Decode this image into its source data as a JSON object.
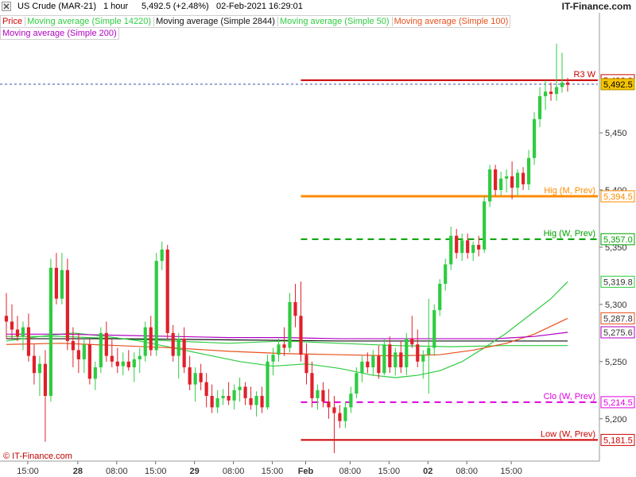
{
  "header": {
    "instrument": "US Crude (MAR-21)",
    "timeframe": "1 hour",
    "quote": "5,492.5 (+2.48%)",
    "datetime": "02-Feb-2021 16:29:01",
    "site": "IT-Finance.com",
    "close_icon": "close-x-icon"
  },
  "legend": {
    "row1": [
      {
        "label": "Price",
        "color": "#d40000"
      },
      {
        "label": "Moving average (Simple 14220)",
        "color": "#2ecc40"
      },
      {
        "label": "Moving average (Simple 2844)",
        "color": "#111111"
      },
      {
        "label": "Moving average (Simple 50)",
        "color": "#2ecc40"
      },
      {
        "label": "Moving average (Simple 100)",
        "color": "#e8501c"
      }
    ],
    "row2": [
      {
        "label": "Moving average (Simple 200)",
        "color": "#b000c0"
      }
    ]
  },
  "footer": {
    "brand": "© IT-Finance.com"
  },
  "chart_data": {
    "type": "candlestick",
    "ylim": [
      5163,
      5555
    ],
    "y_ticks": [
      "5,200",
      "5,250",
      "5,300",
      "5,350",
      "5,400",
      "5,450"
    ],
    "x_ticks": [
      "15:00",
      "28",
      "08:00",
      "15:00",
      "29",
      "08:00",
      "15:00",
      "Feb",
      "08:00",
      "15:00",
      "02",
      "08:00",
      "15:00"
    ],
    "bold_ticks": [
      "28",
      "29",
      "Feb",
      "02"
    ],
    "candles": [
      [
        5290,
        5310,
        5270,
        5285
      ],
      [
        5285,
        5300,
        5270,
        5278
      ],
      [
        5278,
        5290,
        5268,
        5272
      ],
      [
        5272,
        5285,
        5260,
        5280
      ],
      [
        5280,
        5292,
        5250,
        5255
      ],
      [
        5255,
        5265,
        5230,
        5240
      ],
      [
        5240,
        5255,
        5220,
        5248
      ],
      [
        5248,
        5260,
        5180,
        5220
      ],
      [
        5220,
        5340,
        5215,
        5332
      ],
      [
        5332,
        5345,
        5300,
        5305
      ],
      [
        5305,
        5345,
        5300,
        5330
      ],
      [
        5330,
        5340,
        5260,
        5268
      ],
      [
        5268,
        5280,
        5245,
        5260
      ],
      [
        5260,
        5275,
        5240,
        5252
      ],
      [
        5252,
        5270,
        5240,
        5265
      ],
      [
        5265,
        5270,
        5230,
        5235
      ],
      [
        5235,
        5250,
        5225,
        5245
      ],
      [
        5245,
        5280,
        5240,
        5275
      ],
      [
        5275,
        5285,
        5250,
        5255
      ],
      [
        5255,
        5270,
        5245,
        5250
      ],
      [
        5250,
        5262,
        5240,
        5246
      ],
      [
        5246,
        5258,
        5238,
        5250
      ],
      [
        5250,
        5260,
        5242,
        5245
      ],
      [
        5245,
        5258,
        5232,
        5252
      ],
      [
        5252,
        5262,
        5240,
        5255
      ],
      [
        5255,
        5285,
        5250,
        5280
      ],
      [
        5280,
        5290,
        5255,
        5260
      ],
      [
        5260,
        5345,
        5255,
        5338
      ],
      [
        5338,
        5355,
        5330,
        5348
      ],
      [
        5348,
        5352,
        5270,
        5275
      ],
      [
        5275,
        5282,
        5250,
        5255
      ],
      [
        5255,
        5275,
        5235,
        5270
      ],
      [
        5270,
        5280,
        5240,
        5245
      ],
      [
        5245,
        5255,
        5225,
        5230
      ],
      [
        5230,
        5245,
        5215,
        5240
      ],
      [
        5240,
        5248,
        5225,
        5232
      ],
      [
        5232,
        5240,
        5210,
        5220
      ],
      [
        5220,
        5230,
        5205,
        5210
      ],
      [
        5210,
        5225,
        5205,
        5218
      ],
      [
        5218,
        5226,
        5212,
        5220
      ],
      [
        5220,
        5232,
        5212,
        5216
      ],
      [
        5216,
        5230,
        5208,
        5225
      ],
      [
        5225,
        5236,
        5215,
        5228
      ],
      [
        5228,
        5232,
        5212,
        5218
      ],
      [
        5218,
        5228,
        5208,
        5212
      ],
      [
        5212,
        5224,
        5202,
        5220
      ],
      [
        5220,
        5228,
        5205,
        5210
      ],
      [
        5210,
        5256,
        5208,
        5250
      ],
      [
        5250,
        5262,
        5238,
        5256
      ],
      [
        5256,
        5270,
        5250,
        5265
      ],
      [
        5265,
        5280,
        5255,
        5262
      ],
      [
        5262,
        5310,
        5258,
        5302
      ],
      [
        5302,
        5318,
        5280,
        5290
      ],
      [
        5290,
        5320,
        5250,
        5256
      ],
      [
        5256,
        5266,
        5230,
        5240
      ],
      [
        5240,
        5250,
        5210,
        5218
      ],
      [
        5218,
        5230,
        5208,
        5225
      ],
      [
        5225,
        5232,
        5210,
        5215
      ],
      [
        5215,
        5226,
        5200,
        5210
      ],
      [
        5210,
        5220,
        5170,
        5205
      ],
      [
        5205,
        5212,
        5192,
        5198
      ],
      [
        5198,
        5215,
        5192,
        5210
      ],
      [
        5210,
        5228,
        5205,
        5222
      ],
      [
        5222,
        5245,
        5218,
        5240
      ],
      [
        5240,
        5255,
        5232,
        5250
      ],
      [
        5250,
        5258,
        5240,
        5245
      ],
      [
        5245,
        5260,
        5238,
        5255
      ],
      [
        5255,
        5264,
        5235,
        5240
      ],
      [
        5240,
        5270,
        5238,
        5265
      ],
      [
        5265,
        5272,
        5240,
        5245
      ],
      [
        5245,
        5262,
        5238,
        5258
      ],
      [
        5258,
        5268,
        5240,
        5245
      ],
      [
        5245,
        5275,
        5238,
        5270
      ],
      [
        5270,
        5290,
        5262,
        5265
      ],
      [
        5265,
        5278,
        5245,
        5250
      ],
      [
        5250,
        5260,
        5235,
        5256
      ],
      [
        5256,
        5305,
        5222,
        5262
      ],
      [
        5262,
        5300,
        5255,
        5295
      ],
      [
        5295,
        5322,
        5290,
        5318
      ],
      [
        5318,
        5340,
        5312,
        5335
      ],
      [
        5335,
        5368,
        5330,
        5360
      ],
      [
        5360,
        5366,
        5340,
        5345
      ],
      [
        5345,
        5362,
        5338,
        5356
      ],
      [
        5356,
        5362,
        5340,
        5345
      ],
      [
        5345,
        5355,
        5338,
        5352
      ],
      [
        5352,
        5360,
        5342,
        5348
      ],
      [
        5348,
        5395,
        5345,
        5390
      ],
      [
        5390,
        5422,
        5385,
        5418
      ],
      [
        5418,
        5422,
        5395,
        5400
      ],
      [
        5400,
        5416,
        5395,
        5410
      ],
      [
        5410,
        5418,
        5398,
        5412
      ],
      [
        5412,
        5425,
        5392,
        5402
      ],
      [
        5402,
        5418,
        5395,
        5415
      ],
      [
        5415,
        5420,
        5400,
        5405
      ],
      [
        5405,
        5435,
        5400,
        5428
      ],
      [
        5428,
        5468,
        5422,
        5462
      ],
      [
        5462,
        5490,
        5455,
        5482
      ],
      [
        5482,
        5496,
        5470,
        5486
      ],
      [
        5486,
        5494,
        5478,
        5484
      ],
      [
        5484,
        5528,
        5478,
        5490
      ],
      [
        5490,
        5520,
        5485,
        5494
      ],
      [
        5494,
        5498,
        5486,
        5492
      ]
    ],
    "moving_averages": [
      {
        "name": "Moving average (Simple 14220)",
        "color": "#2ecc40",
        "values": [
          [
            0,
            5272
          ],
          [
            10,
            5272
          ],
          [
            20,
            5270
          ],
          [
            30,
            5268
          ],
          [
            40,
            5266
          ],
          [
            50,
            5268
          ],
          [
            60,
            5266
          ],
          [
            70,
            5264
          ],
          [
            80,
            5263
          ],
          [
            90,
            5264
          ],
          [
            101,
            5264
          ]
        ]
      },
      {
        "name": "Moving average (Simple 2844)",
        "color": "#111111",
        "values": [
          [
            0,
            5270
          ],
          [
            20,
            5270
          ],
          [
            40,
            5269
          ],
          [
            60,
            5268
          ],
          [
            80,
            5268
          ],
          [
            101,
            5268
          ]
        ]
      },
      {
        "name": "Moving average (Simple 50)",
        "color": "#2ecc40",
        "values": [
          [
            0,
            5268
          ],
          [
            6,
            5272
          ],
          [
            12,
            5275
          ],
          [
            18,
            5272
          ],
          [
            24,
            5268
          ],
          [
            30,
            5262
          ],
          [
            36,
            5256
          ],
          [
            42,
            5250
          ],
          [
            48,
            5246
          ],
          [
            54,
            5248
          ],
          [
            60,
            5244
          ],
          [
            66,
            5238
          ],
          [
            70,
            5236
          ],
          [
            74,
            5238
          ],
          [
            78,
            5242
          ],
          [
            82,
            5250
          ],
          [
            86,
            5262
          ],
          [
            90,
            5275
          ],
          [
            94,
            5290
          ],
          [
            98,
            5305
          ],
          [
            101,
            5319.8
          ]
        ]
      },
      {
        "name": "Moving average (Simple 100)",
        "color": "#e8501c",
        "values": [
          [
            0,
            5265
          ],
          [
            10,
            5266
          ],
          [
            20,
            5264
          ],
          [
            30,
            5262
          ],
          [
            40,
            5259
          ],
          [
            50,
            5257
          ],
          [
            60,
            5256
          ],
          [
            70,
            5255
          ],
          [
            78,
            5256
          ],
          [
            84,
            5260
          ],
          [
            90,
            5266
          ],
          [
            95,
            5274
          ],
          [
            101,
            5287.8
          ]
        ]
      },
      {
        "name": "Moving average (Simple 200)",
        "color": "#b000c0",
        "values": [
          [
            0,
            5274
          ],
          [
            10,
            5274
          ],
          [
            20,
            5273
          ],
          [
            30,
            5272
          ],
          [
            40,
            5271
          ],
          [
            50,
            5271
          ],
          [
            60,
            5270
          ],
          [
            70,
            5270
          ],
          [
            80,
            5270
          ],
          [
            88,
            5270
          ],
          [
            95,
            5272
          ],
          [
            101,
            5275.6
          ]
        ]
      }
    ],
    "levels": [
      {
        "label": "R3 W",
        "value": 5496.0,
        "tag": "5,496.0",
        "color": "#cc0000",
        "style": "solid",
        "start": 53
      },
      {
        "label": "Hig (M, Prev)",
        "value": 5394.5,
        "tag": "5,394.5",
        "color": "#ff8c00",
        "style": "solid",
        "start": 53
      },
      {
        "label": "Hig (W, Prev)",
        "value": 5357.0,
        "tag": "5,357.0",
        "color": "#00a000",
        "style": "dashed",
        "start": 53
      },
      {
        "label": "Clo (W, Prev)",
        "value": 5214.5,
        "tag": "5,214.5",
        "color": "#e000e0",
        "style": "dashed",
        "start": 53
      },
      {
        "label": "Low (W, Prev)",
        "value": 5181.5,
        "tag": "5,181.5",
        "color": "#cc0000",
        "style": "solid",
        "start": 53
      }
    ],
    "ma_tags": [
      {
        "value": 5319.8,
        "tag": "5,319.8",
        "color": "#2ecc40"
      },
      {
        "value": 5287.8,
        "tag": "5,287.8",
        "color": "#e8501c"
      },
      {
        "value": 5275.6,
        "tag": "5,275.6",
        "color": "#b000c0"
      }
    ],
    "last_price": {
      "value": 5492.5,
      "tag": "5,492.5",
      "color": "#f5c400"
    },
    "colors": {
      "up": "#2ecc40",
      "down": "#e0202a",
      "grid": "#e6e6e6",
      "axis": "#999999"
    }
  }
}
